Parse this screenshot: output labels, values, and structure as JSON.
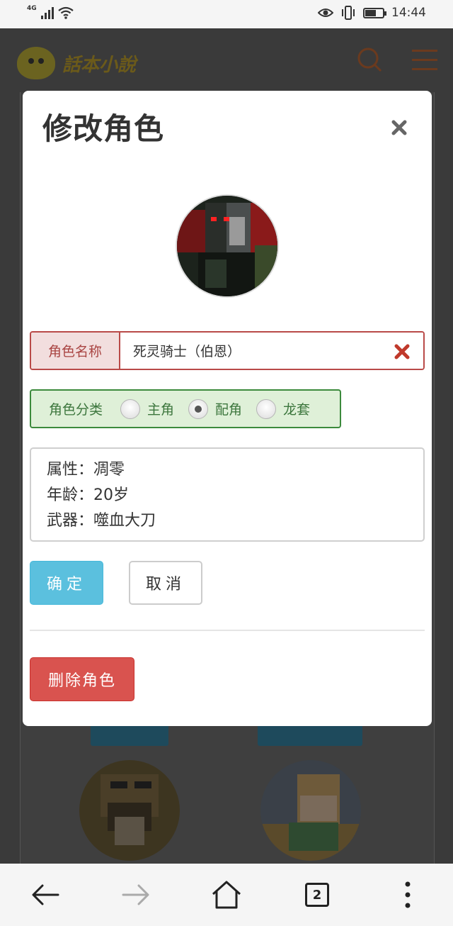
{
  "status_bar": {
    "network": "4G",
    "time": "14:44",
    "battery_level": 0.62
  },
  "site": {
    "logo_text": "話本小說",
    "buttons": [
      "",
      ""
    ]
  },
  "modal": {
    "title": "修改角色",
    "name_label": "角色名称",
    "name_value": "死灵骑士（伯恩）",
    "category_label": "角色分类",
    "category_options": [
      "主角",
      "配角",
      "龙套"
    ],
    "category_selected": "配角",
    "description_lines": [
      "属性：凋零",
      "年龄：20岁",
      "武器：噬血大刀"
    ],
    "confirm_label": "确定",
    "cancel_label": "取消",
    "delete_label": "删除角色"
  },
  "bottom_nav": {
    "tab_count": "2"
  },
  "colors": {
    "primary": "#5bc0de",
    "danger": "#d9534f",
    "error_border": "#b94a48",
    "success_bg": "#dff0d8"
  }
}
